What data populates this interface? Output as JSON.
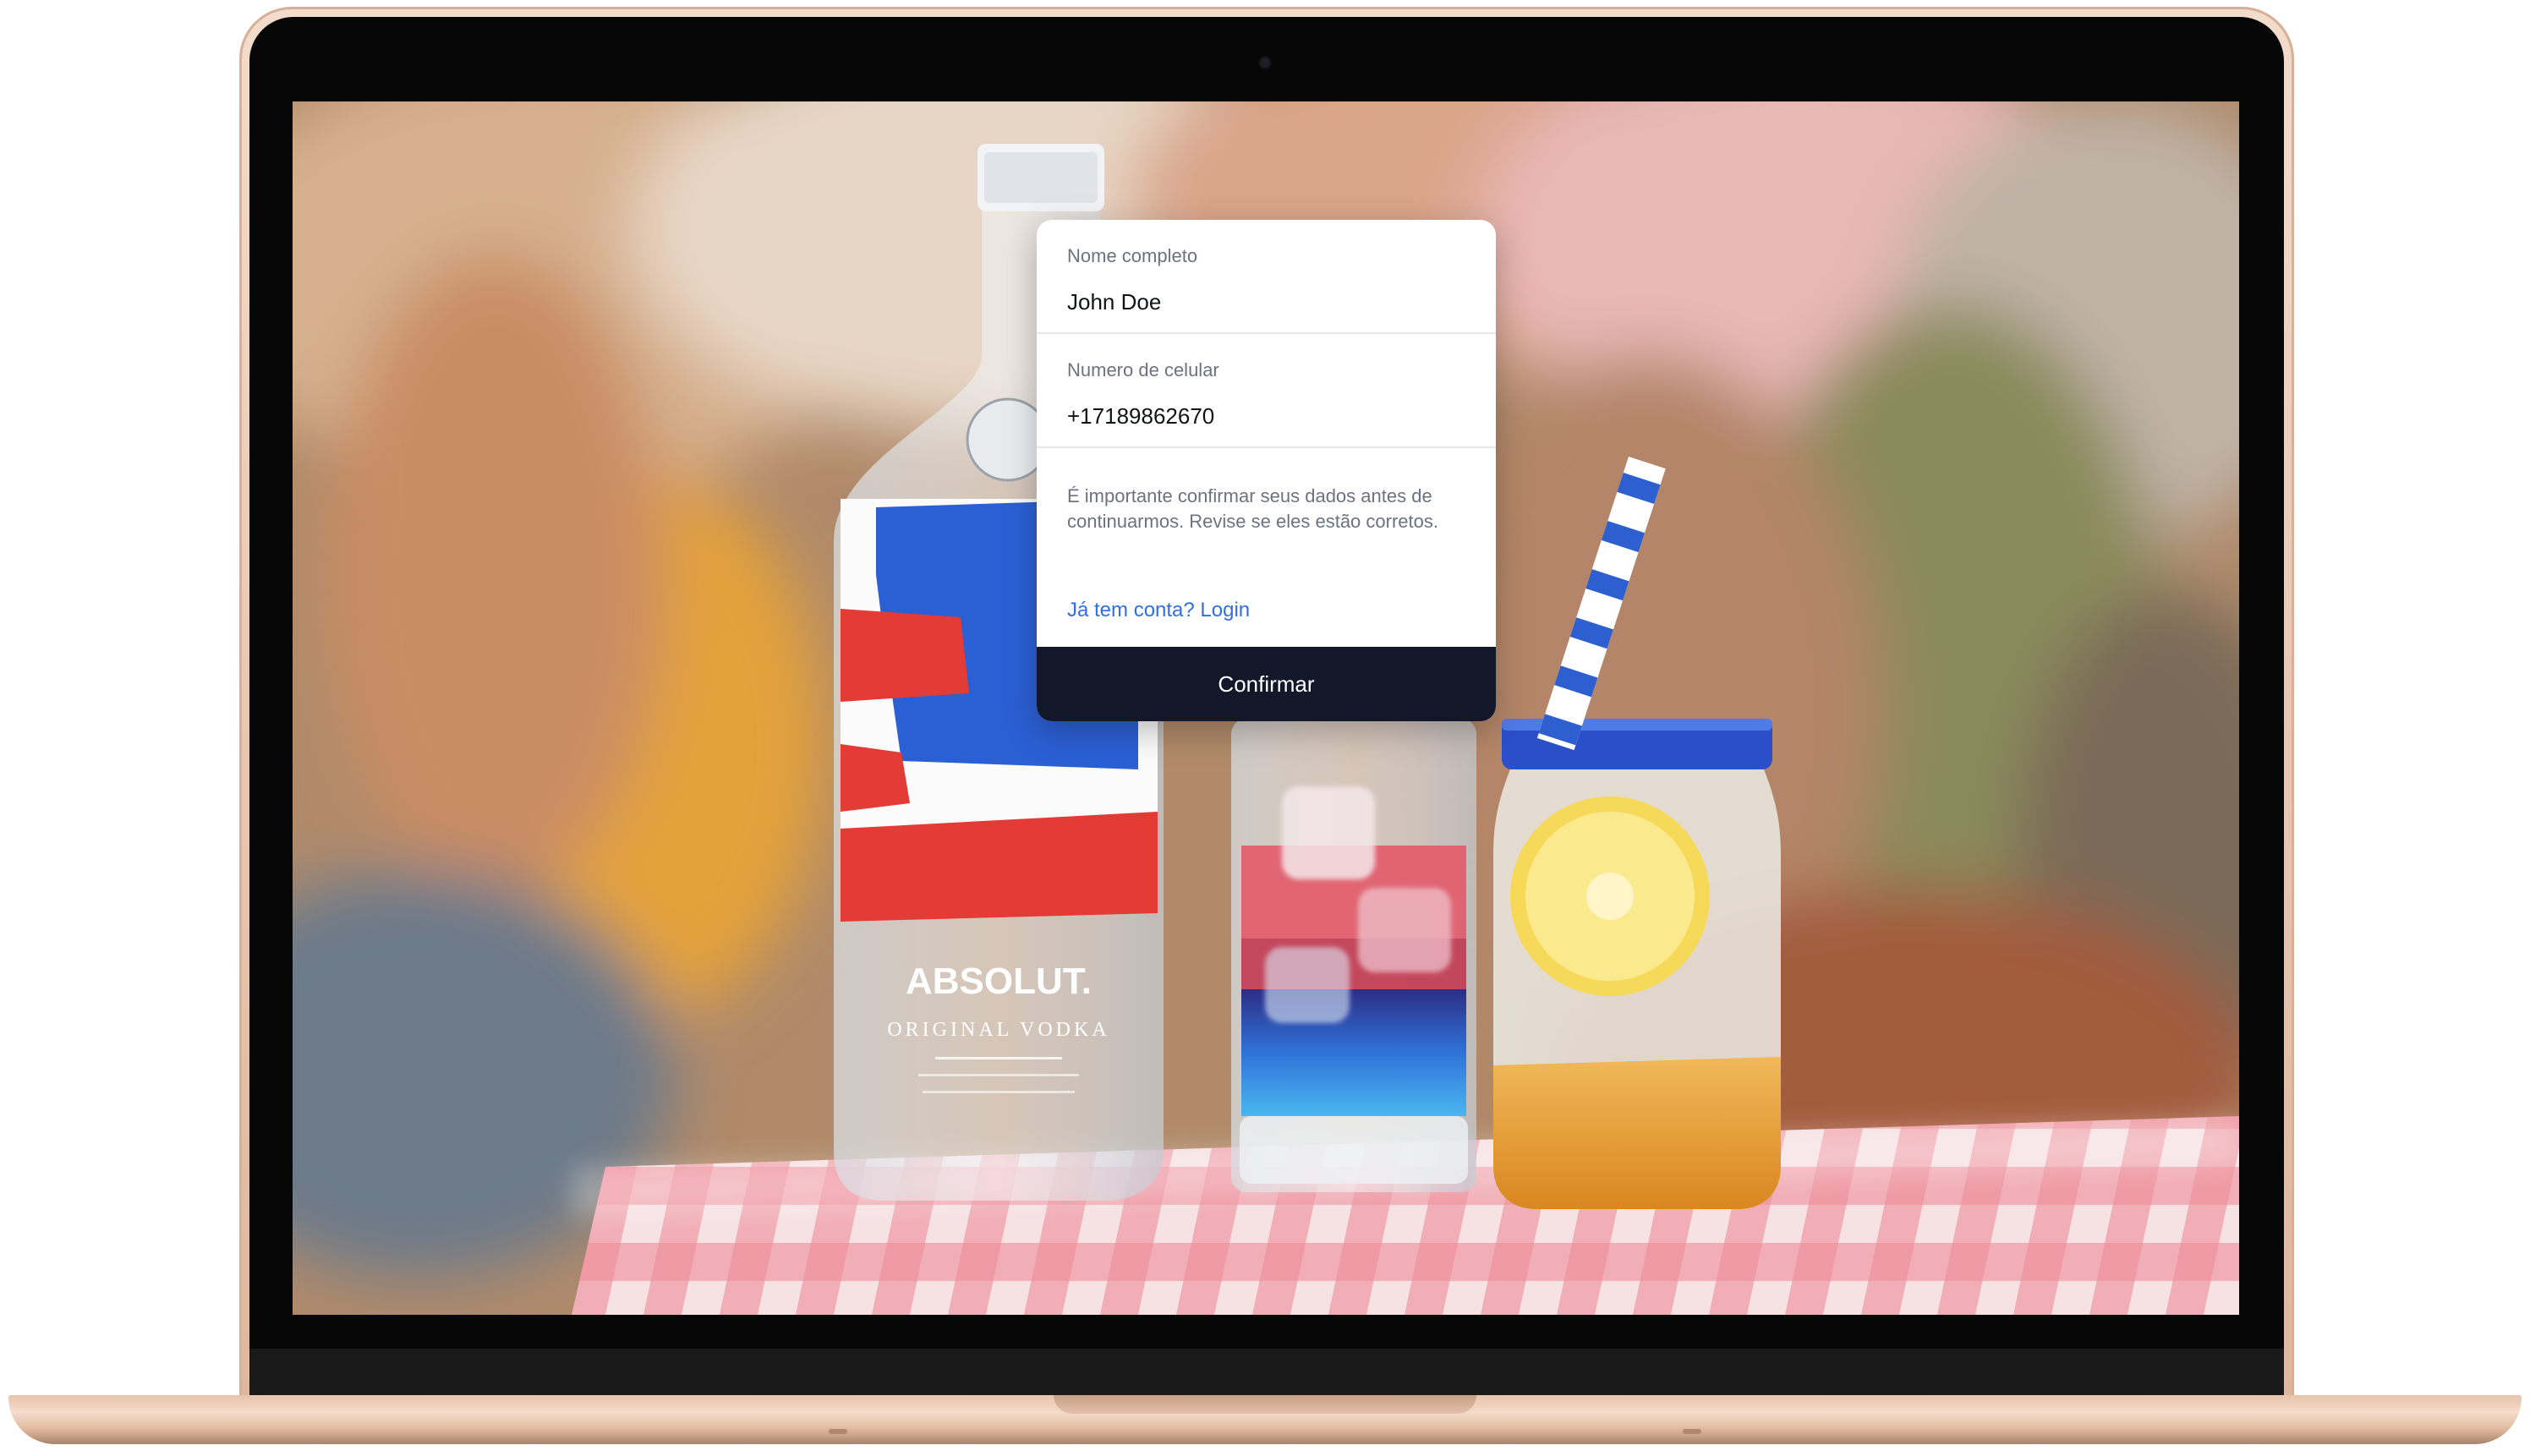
{
  "form": {
    "name_label": "Nome completo",
    "name_value": "John Doe",
    "phone_label": "Numero de celular",
    "phone_value": "+17189862670",
    "note": "É importante confirmar seus dados antes de continuarmos. Revise se eles estão corretos.",
    "login_link": "Já tem conta? Login",
    "confirm_label": "Confirmar"
  },
  "background_photo": {
    "bottle_brand": "ABSOLUT.",
    "bottle_sub": "ORIGINAL VODKA"
  },
  "colors": {
    "confirm_button": "#12172a",
    "link": "#2f6fe0",
    "laptop_finish": "#e9c8b2"
  }
}
